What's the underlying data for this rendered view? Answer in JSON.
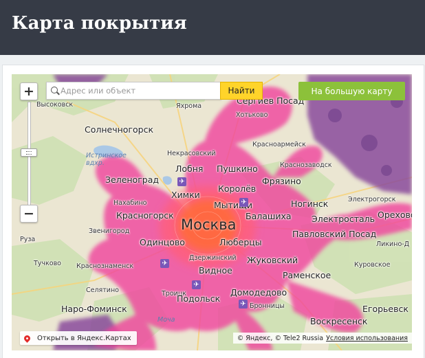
{
  "page": {
    "title": "Карта покрытия"
  },
  "search": {
    "placeholder": "Адрес или объект",
    "button": "Найти"
  },
  "big_map_button": "На большую карту",
  "open_yandex": "Открыть в Яндекс.Картах",
  "copyright": "© Яндекс, © Tele2 Russia",
  "terms": "Условия использования",
  "labels": {
    "vysokovsk": "Высоковск",
    "sergiev_posad": "Сергиев Посад",
    "yakhroma": "Яхрома",
    "khotkovo": "Хотьково",
    "solnechnogorsk": "Солнечногорск",
    "krasnoarmeysk": "Красноармейск",
    "istra_reservoir": "Истринское вдхр.",
    "nekrasovsky": "Некрасовский",
    "lobnya": "Лобня",
    "pushkino": "Пушкино",
    "krasnozavodsk": "Краснозаводск",
    "zelenograd": "Зеленоград",
    "korolev": "Королёв",
    "fryazino": "Фрязино",
    "khimki": "Химки",
    "elektrogorsk": "Электрогорск",
    "nakhabino": "Нахабино",
    "mytishchi": "Мытищи",
    "balashikha": "Балашиха",
    "noginsk": "Ногинск",
    "krasnogorsk": "Красногорск",
    "elektrostal": "Электросталь",
    "orekhovo": "Орехово",
    "moscow": "Москва",
    "zvenigorod": "Звенигород",
    "odintsovo": "Одинцово",
    "lyubertsy": "Люберцы",
    "pavlovsky_posad": "Павловский Посад",
    "ruza": "Руза",
    "likino": "Ликино-Д",
    "dzerzhinsky": "Дзержинский",
    "zhukovsky": "Жуковский",
    "tuchkovo": "Тучково",
    "krasnoznamensk": "Краснознаменск",
    "vidnoe": "Видное",
    "kurovskoe": "Куровское",
    "ramenskoe": "Раменское",
    "selyatino": "Селятино",
    "troitsk": "Троицк",
    "podolsk": "Подольск",
    "domodedovo": "Домодедово",
    "bronnitsy": "Бронницы",
    "naro_fominsk": "Наро-Фоминск",
    "egoryevsk": "Егорьевск",
    "voskresensk": "Воскресенск",
    "mocha": "Моча"
  },
  "colors": {
    "header_bg": "#363b46",
    "coverage_pink": "#f0479e",
    "coverage_center": "#ff6a3c",
    "coverage_4g": "#8a4c9c",
    "find_button": "#ffd42a",
    "big_map_button": "#8cc13a"
  },
  "icons": {
    "search": "magnifier",
    "airport": "plane",
    "zoom_in": "plus",
    "zoom_out": "minus",
    "place": "map-pin"
  }
}
